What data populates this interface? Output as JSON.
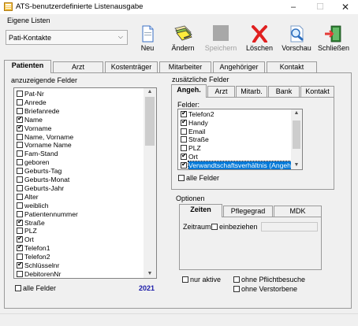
{
  "window": {
    "title": "ATS-benutzerdefinierte Listenausgabe",
    "min_glyph": "–",
    "max_glyph": "☐",
    "close_glyph": "✕"
  },
  "lists": {
    "group_label": "Eigene Listen",
    "selected": "Pati-Kontakte",
    "arrow": "⌵"
  },
  "toolbar": {
    "new_label": "Neu",
    "edit_label": "Ändern",
    "save_label": "Speichern",
    "delete_label": "Löschen",
    "preview_label": "Vorschau",
    "close_label": "Schließen"
  },
  "main_tabs": [
    "Patienten",
    "Arzt",
    "Kostenträger",
    "Mitarbeiter",
    "Angehöriger",
    "Kontakt"
  ],
  "fields": {
    "group_label": "anzuzeigende Felder",
    "items": [
      {
        "label": "Pat-Nr",
        "checked": false
      },
      {
        "label": "Anrede",
        "checked": false
      },
      {
        "label": "Briefanrede",
        "checked": false
      },
      {
        "label": "Name",
        "checked": true
      },
      {
        "label": "Vorname",
        "checked": true
      },
      {
        "label": "Name, Vorname",
        "checked": false
      },
      {
        "label": "Vorname Name",
        "checked": false
      },
      {
        "label": "Fam-Stand",
        "checked": false
      },
      {
        "label": "geboren",
        "checked": false
      },
      {
        "label": "Geburts-Tag",
        "checked": false
      },
      {
        "label": "Geburts-Monat",
        "checked": false
      },
      {
        "label": "Geburts-Jahr",
        "checked": false
      },
      {
        "label": "Alter",
        "checked": false
      },
      {
        "label": "weiblich",
        "checked": false
      },
      {
        "label": "Patientennummer",
        "checked": false
      },
      {
        "label": "Straße",
        "checked": true
      },
      {
        "label": "PLZ",
        "checked": false
      },
      {
        "label": "Ort",
        "checked": true
      },
      {
        "label": "Telefon1",
        "checked": true
      },
      {
        "label": "Telefon2",
        "checked": false
      },
      {
        "label": "Schlüsselnr",
        "checked": true
      },
      {
        "label": "DebitorenNr",
        "checked": false
      }
    ],
    "all_label": "alle Felder",
    "year": "2021"
  },
  "extra": {
    "group_label": "zusätzliche Felder",
    "tabs": [
      "Angeh.",
      "Arzt",
      "Mitarb.",
      "Bank",
      "Kontakt"
    ],
    "list_label": "Felder:",
    "items": [
      {
        "label": "Telefon2",
        "checked": true
      },
      {
        "label": "Handy",
        "checked": true
      },
      {
        "label": "Email",
        "checked": false
      },
      {
        "label": "Straße",
        "checked": false
      },
      {
        "label": "PLZ",
        "checked": false
      },
      {
        "label": "Ort",
        "checked": true
      },
      {
        "label": "Verwandtschaftsverhältnis (Angehörige)",
        "checked": true,
        "selected": true
      }
    ],
    "all_label": "alle Felder"
  },
  "options": {
    "group_label": "Optionen",
    "tabs": [
      "Zeiten",
      "Pflegegrad",
      "MDK"
    ],
    "timespan_label": "Zeitraum",
    "include_label": "einbeziehen"
  },
  "filters": {
    "active_only": "nur aktive",
    "no_mandatory": "ohne Pflichtbesuche",
    "no_deceased": "ohne Verstorbene"
  },
  "scroll": {
    "up": "▲",
    "down": "▼"
  },
  "colors": {
    "selection": "#0078d7",
    "year": "#1a1aa8",
    "delete": "#e02020"
  }
}
